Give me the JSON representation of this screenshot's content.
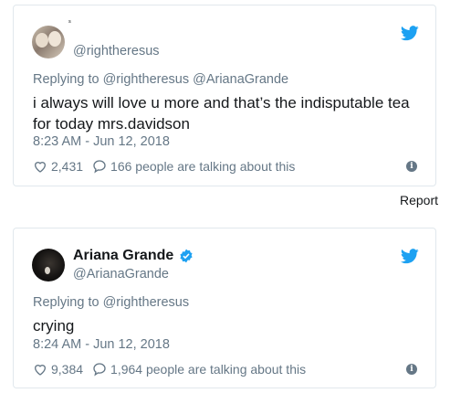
{
  "tweets": [
    {
      "display_name": "",
      "handle": "@rightheresus",
      "small_mark": "ˢ",
      "reply_prefix": "Replying to",
      "reply_mentions": "@rightheresus @ArianaGrande",
      "text": "i always will love u more and that’s the indisputable tea for today mrs.davidson",
      "timestamp": "8:23 AM - Jun 12, 2018",
      "likes": "2,431",
      "talking": "166 people are talking about this",
      "info_glyph": "i",
      "icons": [
        "heart-icon",
        "comment-icon",
        "info-icon",
        "twitter-bird-icon"
      ]
    },
    {
      "display_name": "Ariana Grande",
      "verified": true,
      "handle": "@ArianaGrande",
      "reply_prefix": "Replying to",
      "reply_mentions": "@rightheresus",
      "text": "crying",
      "timestamp": "8:24 AM - Jun 12, 2018",
      "likes": "9,384",
      "talking": "1,964 people are talking about this",
      "info_glyph": "i",
      "icons": [
        "heart-icon",
        "comment-icon",
        "info-icon",
        "twitter-bird-icon",
        "verified-badge-icon"
      ]
    }
  ],
  "report_label": "Report",
  "colors": {
    "twitter_blue": "#1da1f2",
    "secondary_text": "#657786",
    "border": "#e1e8ed"
  }
}
